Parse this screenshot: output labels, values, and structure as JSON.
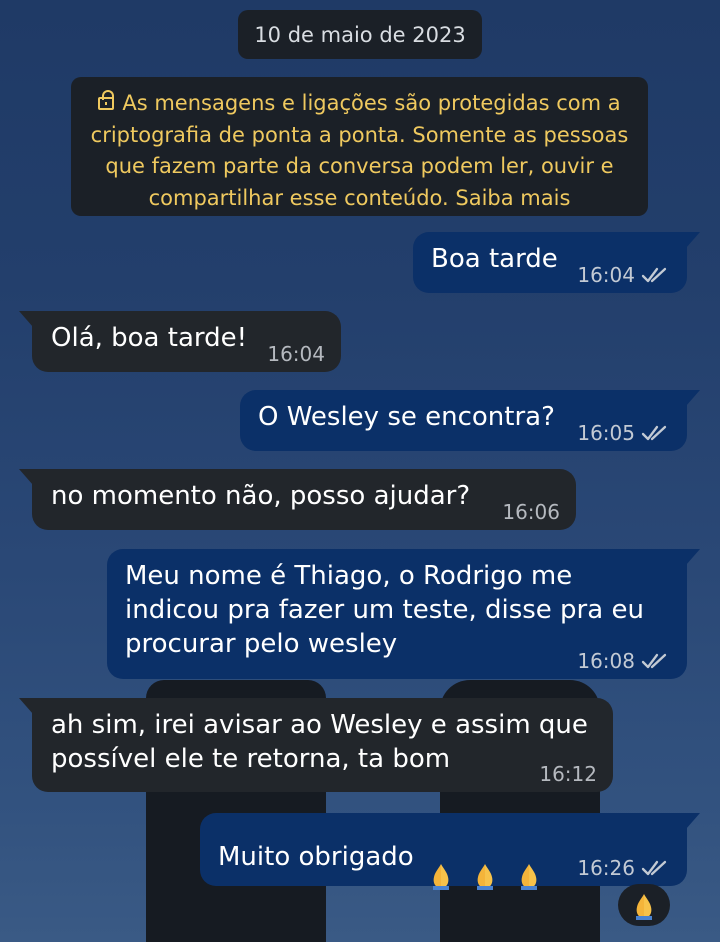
{
  "date_chip": "10 de maio de 2023",
  "encryption_notice": {
    "lines": [
      "As mensagens e ligações são protegidas com a",
      "criptografia de ponta a ponta. Somente as pessoas",
      "que fazem parte da conversa podem ler, ouvir e",
      "compartilhar esse conteúdo. Saiba mais"
    ],
    "icon": "lock-icon",
    "color": "#efc95f"
  },
  "messages": [
    {
      "direction": "outgoing",
      "text": "Boa tarde",
      "time": "16:04",
      "status": "read"
    },
    {
      "direction": "incoming",
      "text": "Olá, boa tarde!",
      "time": "16:04"
    },
    {
      "direction": "outgoing",
      "text": "O Wesley se encontra?",
      "time": "16:05",
      "status": "read"
    },
    {
      "direction": "incoming",
      "text": "no momento não, posso ajudar?",
      "time": "16:06"
    },
    {
      "direction": "outgoing",
      "text": "Meu nome é Thiago, o Rodrigo me\nindicou pra fazer um teste, disse pra eu\nprocurar pelo wesley",
      "time": "16:08",
      "status": "read"
    },
    {
      "direction": "incoming",
      "text": "ah sim, irei avisar ao Wesley e assim que\npossível ele te retorna, ta bom",
      "time": "16:12"
    },
    {
      "direction": "outgoing",
      "text": "Muito obrigado",
      "emojis": [
        "folded-hands-emoji",
        "folded-hands-emoji",
        "folded-hands-emoji"
      ],
      "time": "16:26",
      "status": "read"
    }
  ],
  "reaction": {
    "emoji": "folded-hands-emoji"
  },
  "colors": {
    "outgoing_bubble": "#0b3068",
    "incoming_bubble": "#22262b",
    "system_chip": "#1b2027",
    "read_ticks": "#c3cad4"
  }
}
